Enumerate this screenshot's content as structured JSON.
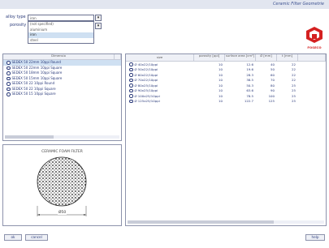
{
  "window": {
    "title": "Ceramic Filter Geometrie"
  },
  "filters": {
    "alloy_type_label": "alloy type",
    "alloy_type_value": "iron",
    "porosity_label": "porosity",
    "alloy_type_options": [
      "(not specified)",
      "aluminium",
      "iron",
      "steel"
    ],
    "selected_option_index": 2
  },
  "logo": {
    "text": "FOSECO",
    "color": "#d42020"
  },
  "filter_list": {
    "header": "Dimensio",
    "items": [
      "SEDEX 50 22mm 10ppi Round",
      "SEDEX 50 22mm 10ppi Square",
      "SEDEX 50 18mm 10ppi Square",
      "SEDEX 50 15mm 10ppi Square",
      "SEDEX 50 22 10ppi Round",
      "SEDEX 50 22 10ppi Square",
      "SEDEX 50 15 10ppi Square"
    ],
    "selected_index": 0
  },
  "preview": {
    "caption": "CERAMIC FOAM FILTER",
    "dimension_label": "Ø50"
  },
  "table": {
    "headers": [
      "size",
      "porosity [ppi]",
      "surface area [cm²]",
      "Ø [mm]",
      "t [mm]"
    ],
    "rows": [
      [
        "Ø 40x22/10ppi",
        "10",
        "12.6",
        "40",
        "22"
      ],
      [
        "Ø 50x22/10ppi",
        "10",
        "19.6",
        "50",
        "22"
      ],
      [
        "Ø 60x22/10ppi",
        "10",
        "28.3",
        "60",
        "22"
      ],
      [
        "Ø 70x22/10ppi",
        "10",
        "38.5",
        "70",
        "22"
      ],
      [
        "Ø 80x25/10ppi",
        "10",
        "50.3",
        "80",
        "25"
      ],
      [
        "Ø 90x25/10ppi",
        "10",
        "63.6",
        "90",
        "25"
      ],
      [
        "Ø 100x25/10ppi",
        "10",
        "78.5",
        "100",
        "25"
      ],
      [
        "Ø 125x25/10ppi",
        "10",
        "122.7",
        "125",
        "25"
      ]
    ]
  },
  "buttons": {
    "ok": "ok",
    "cancel": "cancel",
    "help": "help"
  }
}
